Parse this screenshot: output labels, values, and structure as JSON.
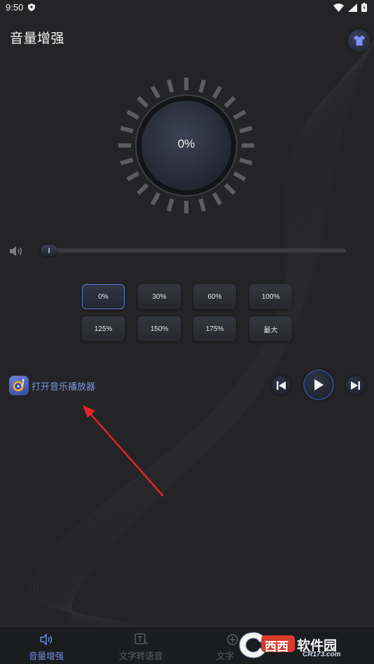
{
  "status_bar": {
    "time": "9:50"
  },
  "header": {
    "title": "音量增强",
    "theme_icon": "tshirt-icon"
  },
  "dial": {
    "percent_label": "0%"
  },
  "volume": {
    "level": 0,
    "icon": "speaker-icon"
  },
  "presets": {
    "items": [
      "0%",
      "30%",
      "60%",
      "100%",
      "125%",
      "150%",
      "175%",
      "最大"
    ],
    "selected_index": 0
  },
  "music": {
    "icon": "record-player-icon",
    "label": "打开音乐播放器",
    "prev_icon": "skip-previous-icon",
    "play_icon": "play-icon",
    "next_icon": "skip-next-icon"
  },
  "bottom_nav": {
    "items": [
      {
        "label": "音量增强",
        "icon": "speaker-icon",
        "active": true
      },
      {
        "label": "文字转语音",
        "icon": "text-to-speech-icon",
        "active": false
      },
      {
        "label": "文字",
        "icon": "plus-circle-icon",
        "active": false
      }
    ]
  },
  "watermark": {
    "brand": "西西",
    "tagline": "软件园",
    "domain": "CR173.com"
  },
  "colors": {
    "background": "#242426",
    "accent": "#6d8ee6",
    "preset_active_border": "#5b7ad8",
    "annotation_arrow": "#e02424"
  }
}
